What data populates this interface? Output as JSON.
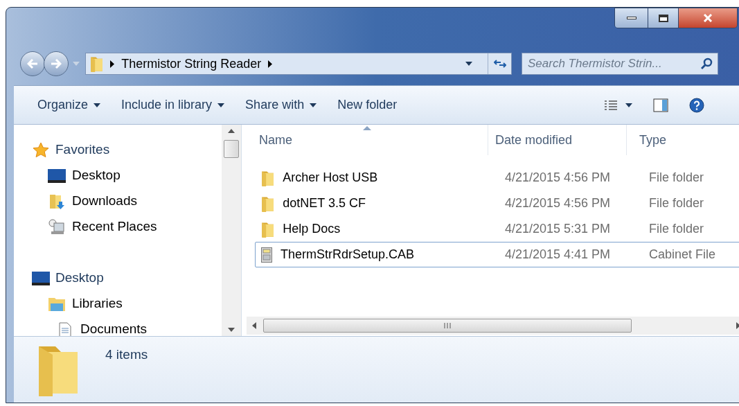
{
  "address": {
    "path": "Thermistor String Reader"
  },
  "search": {
    "placeholder": "Search Thermistor Strin..."
  },
  "toolbar": [
    {
      "label": "Organize",
      "dropdown": true
    },
    {
      "label": "Include in library",
      "dropdown": true
    },
    {
      "label": "Share with",
      "dropdown": true
    },
    {
      "label": "New folder",
      "dropdown": false
    }
  ],
  "navigation": [
    {
      "label": "Favorites",
      "children": [
        {
          "label": "Desktop"
        },
        {
          "label": "Downloads"
        },
        {
          "label": "Recent Places"
        }
      ]
    },
    {
      "label": "Desktop",
      "children": [
        {
          "label": "Libraries",
          "children": [
            {
              "label": "Documents"
            }
          ]
        }
      ]
    }
  ],
  "columns": [
    {
      "label": "Name",
      "sorted": true
    },
    {
      "label": "Date modified",
      "sorted": false
    },
    {
      "label": "Type",
      "sorted": false
    }
  ],
  "files": [
    {
      "kind": "folder",
      "name": "Archer Host USB",
      "date": "4/21/2015 4:56 PM",
      "type": "File folder",
      "focused": false
    },
    {
      "kind": "folder",
      "name": "dotNET 3.5 CF",
      "date": "4/21/2015 4:56 PM",
      "type": "File folder",
      "focused": false
    },
    {
      "kind": "folder",
      "name": "Help Docs",
      "date": "4/21/2015 5:31 PM",
      "type": "File folder",
      "focused": false
    },
    {
      "kind": "cabinet",
      "name": "ThermStrRdrSetup.CAB",
      "date": "4/21/2015 4:41 PM",
      "type": "Cabinet File",
      "focused": true
    }
  ],
  "status_bar": {
    "count": "4 items"
  }
}
